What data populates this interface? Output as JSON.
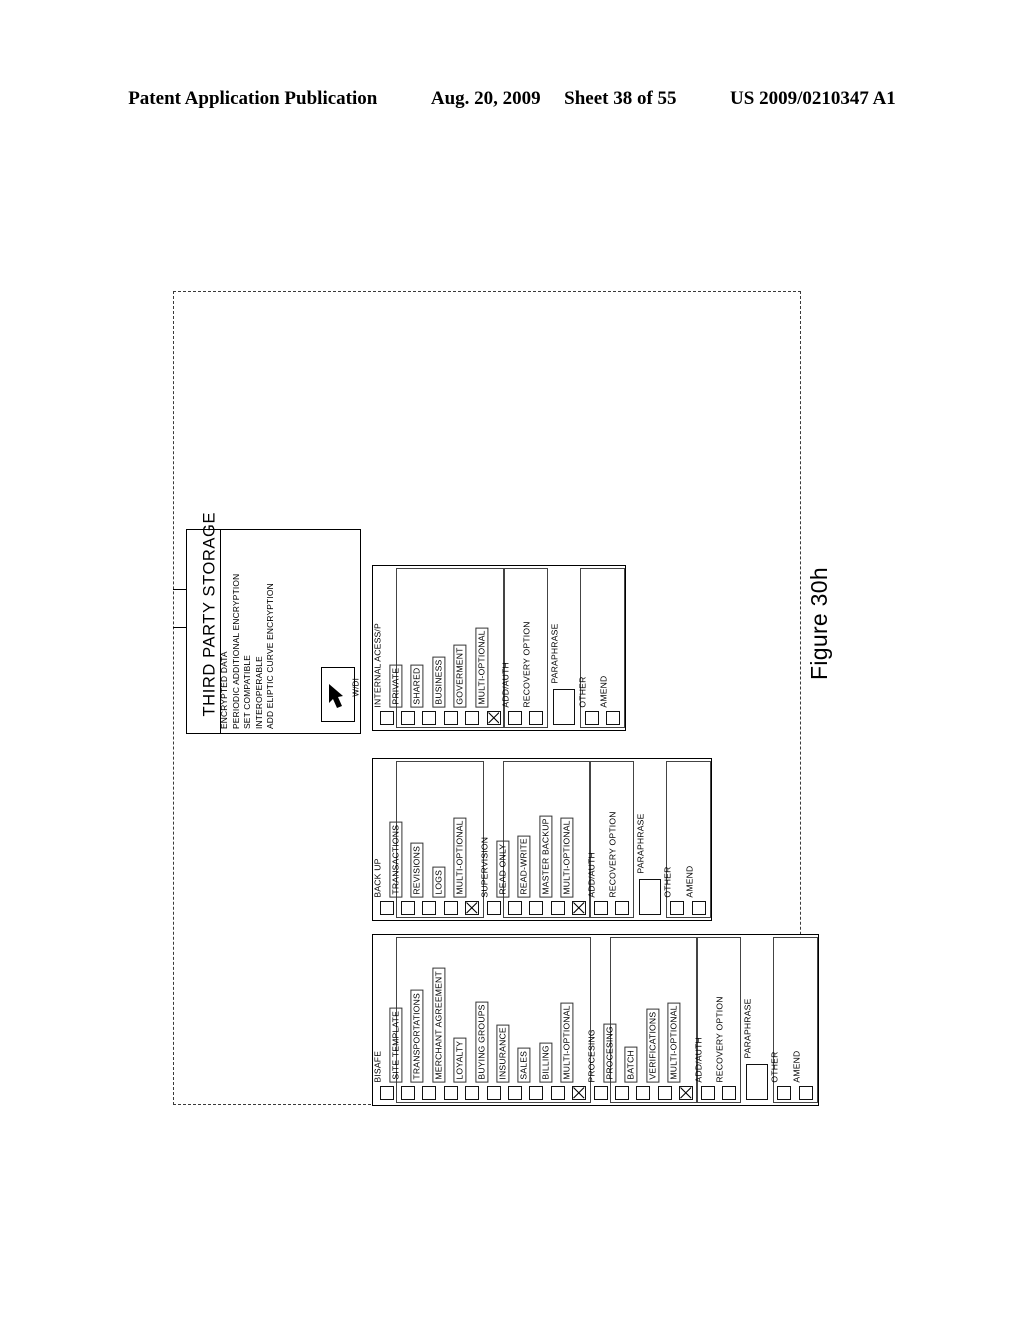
{
  "page_header": {
    "publication": "Patent Application Publication",
    "date": "Aug. 20, 2009",
    "sheet": "Sheet 38 of 55",
    "patent_number": "US 2009/0210347 A1"
  },
  "figure": {
    "caption": "Figure 30h"
  },
  "third_party_storage": {
    "title": "THIRD PARTY STORAGE",
    "lines": [
      "ENCRYPTED DATA",
      "PERIODIC ADDITIONAL ENCRYPTION",
      "SET COMPATIBLE",
      "INTEROPERABLE",
      "ADD ELIPTIC CURVE ENCRYPTION"
    ],
    "button": {
      "label": "W/DI",
      "icon": "arrow-icon"
    }
  },
  "panels": [
    {
      "id": "internal-access",
      "cells": [
        {
          "label": "INTERNAL ACESS/P",
          "type": "checkbox",
          "checked": false,
          "boxed": false,
          "group": null
        },
        {
          "label": "PRIVATE",
          "type": "checkbox",
          "checked": false,
          "boxed": true,
          "group": "g1"
        },
        {
          "label": "SHARED",
          "type": "checkbox",
          "checked": false,
          "boxed": true,
          "group": "g1"
        },
        {
          "label": "BUSINESS",
          "type": "checkbox",
          "checked": false,
          "boxed": true,
          "group": "g1"
        },
        {
          "label": "GOVERMENT",
          "type": "checkbox",
          "checked": false,
          "boxed": true,
          "group": "g1"
        },
        {
          "label": "MULTI-OPTIONAL",
          "type": "checkbox",
          "checked": true,
          "boxed": true,
          "group": "g1"
        },
        {
          "label": "ADD/AUTH",
          "type": "checkbox",
          "checked": false,
          "boxed": false,
          "group": "g2"
        },
        {
          "label": "RECOVERY OPTION",
          "type": "checkbox",
          "checked": false,
          "boxed": false,
          "group": "g2"
        },
        {
          "label": "PARAPHRASE",
          "type": "field",
          "checked": false,
          "boxed": false,
          "group": null
        },
        {
          "label": "OTHER",
          "type": "checkbox",
          "checked": false,
          "boxed": false,
          "group": "g3"
        },
        {
          "label": "AMEND",
          "type": "checkbox",
          "checked": false,
          "boxed": false,
          "group": "g3"
        }
      ]
    },
    {
      "id": "back-up-supervision",
      "cells": [
        {
          "label": "BACK UP",
          "type": "checkbox",
          "checked": false,
          "boxed": false,
          "group": null
        },
        {
          "label": "TRANSACTIONS",
          "type": "checkbox",
          "checked": false,
          "boxed": true,
          "group": "g1"
        },
        {
          "label": "REVISIONS",
          "type": "checkbox",
          "checked": false,
          "boxed": true,
          "group": "g1"
        },
        {
          "label": "LOGS",
          "type": "checkbox",
          "checked": false,
          "boxed": true,
          "group": "g1"
        },
        {
          "label": "MULTI-OPTIONAL",
          "type": "checkbox",
          "checked": true,
          "boxed": true,
          "group": "g1"
        },
        {
          "label": "SUPERVISION",
          "type": "checkbox",
          "checked": false,
          "boxed": false,
          "group": null
        },
        {
          "label": "READ ONLY",
          "type": "checkbox",
          "checked": false,
          "boxed": true,
          "group": "g2"
        },
        {
          "label": "READ-WRITE",
          "type": "checkbox",
          "checked": false,
          "boxed": true,
          "group": "g2"
        },
        {
          "label": "MASTER BACKUP",
          "type": "checkbox",
          "checked": false,
          "boxed": true,
          "group": "g2"
        },
        {
          "label": "MULTI-OPTIONAL",
          "type": "checkbox",
          "checked": true,
          "boxed": true,
          "group": "g2"
        },
        {
          "label": "ADD/AUTH",
          "type": "checkbox",
          "checked": false,
          "boxed": false,
          "group": "g3"
        },
        {
          "label": "RECOVERY OPTION",
          "type": "checkbox",
          "checked": false,
          "boxed": false,
          "group": "g3"
        },
        {
          "label": "PARAPHRASE",
          "type": "field",
          "checked": false,
          "boxed": false,
          "group": null
        },
        {
          "label": "OTHER",
          "type": "checkbox",
          "checked": false,
          "boxed": false,
          "group": "g4"
        },
        {
          "label": "AMEND",
          "type": "checkbox",
          "checked": false,
          "boxed": false,
          "group": "g4"
        }
      ]
    },
    {
      "id": "bisafe-procesing",
      "cells": [
        {
          "label": "BISAFE",
          "type": "checkbox",
          "checked": false,
          "boxed": false,
          "group": null
        },
        {
          "label": "SITE TEMPLATE",
          "type": "checkbox",
          "checked": false,
          "boxed": true,
          "group": "g1"
        },
        {
          "label": "TRANSPORTATIONS",
          "type": "checkbox",
          "checked": false,
          "boxed": true,
          "group": "g1"
        },
        {
          "label": "MERCHANT AGREEMENT",
          "type": "checkbox",
          "checked": false,
          "boxed": true,
          "group": "g1"
        },
        {
          "label": "LOYALTY",
          "type": "checkbox",
          "checked": false,
          "boxed": true,
          "group": "g1"
        },
        {
          "label": "BUYING GROUPS",
          "type": "checkbox",
          "checked": false,
          "boxed": true,
          "group": "g1"
        },
        {
          "label": "INSURANCE",
          "type": "checkbox",
          "checked": false,
          "boxed": true,
          "group": "g1"
        },
        {
          "label": "SALES",
          "type": "checkbox",
          "checked": false,
          "boxed": true,
          "group": "g1"
        },
        {
          "label": "BILLING",
          "type": "checkbox",
          "checked": false,
          "boxed": true,
          "group": "g1"
        },
        {
          "label": "MULTI-OPTIONAL",
          "type": "checkbox",
          "checked": true,
          "boxed": true,
          "group": "g1"
        },
        {
          "label": "PROCESING",
          "type": "checkbox",
          "checked": false,
          "boxed": false,
          "group": null
        },
        {
          "label": "PROCESING",
          "type": "checkbox",
          "checked": false,
          "boxed": true,
          "group": "g2"
        },
        {
          "label": "BATCH",
          "type": "checkbox",
          "checked": false,
          "boxed": true,
          "group": "g2"
        },
        {
          "label": "VERIFICATIONS",
          "type": "checkbox",
          "checked": false,
          "boxed": true,
          "group": "g2"
        },
        {
          "label": "MULTI-OPTIONAL",
          "type": "checkbox",
          "checked": true,
          "boxed": true,
          "group": "g2"
        },
        {
          "label": "ADD/AUTH",
          "type": "checkbox",
          "checked": false,
          "boxed": false,
          "group": "g3"
        },
        {
          "label": "RECOVERY OPTION",
          "type": "checkbox",
          "checked": false,
          "boxed": false,
          "group": "g3"
        },
        {
          "label": "PARAPHRASE",
          "type": "field",
          "checked": false,
          "boxed": false,
          "group": null
        },
        {
          "label": "OTHER",
          "type": "checkbox",
          "checked": false,
          "boxed": false,
          "group": "g4"
        },
        {
          "label": "AMEND",
          "type": "checkbox",
          "checked": false,
          "boxed": false,
          "group": "g4"
        }
      ]
    }
  ],
  "colors": {
    "ink": "#000000",
    "paper": "#ffffff",
    "dashed_border": "#3a3a3a"
  }
}
